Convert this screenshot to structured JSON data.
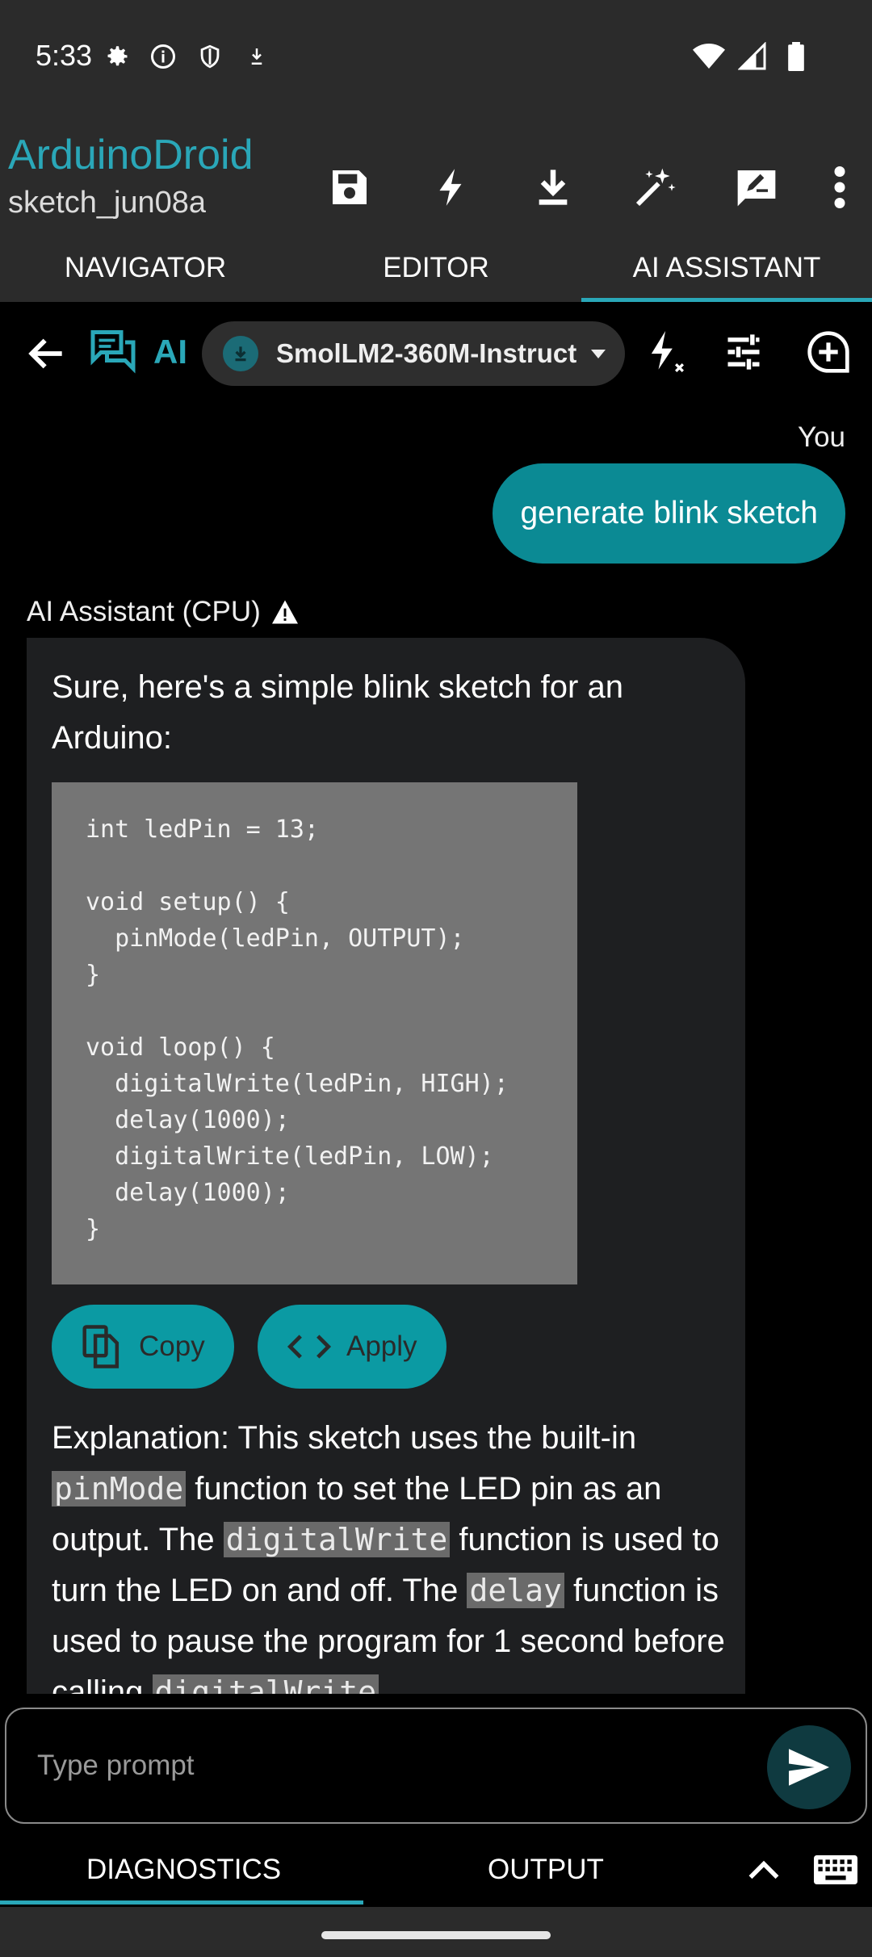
{
  "status_bar": {
    "time": "5:33"
  },
  "app": {
    "title": "ArduinoDroid",
    "subtitle": "sketch_jun08a"
  },
  "tabs": [
    {
      "label": "NAVIGATOR",
      "active": false
    },
    {
      "label": "EDITOR",
      "active": false
    },
    {
      "label": "AI ASSISTANT",
      "active": true
    }
  ],
  "chat_toolbar": {
    "ai_label": "AI",
    "model": "SmolLM2-360M-Instruct"
  },
  "messages": {
    "user_label": "You",
    "user_text": "generate blink sketch",
    "ai_label": "AI Assistant (CPU)",
    "ai_intro": "Sure, here's a simple blink sketch for an Arduino:",
    "code": "int ledPin = 13;\n\nvoid setup() {\n  pinMode(ledPin, OUTPUT);\n}\n\nvoid loop() {\n  digitalWrite(ledPin, HIGH);\n  delay(1000);\n  digitalWrite(ledPin, LOW);\n  delay(1000);\n}",
    "copy_label": "Copy",
    "apply_label": "Apply",
    "explanation": {
      "t1": "Explanation: This sketch uses the built-in ",
      "c1": "pinMode",
      "t2": " function to set the LED pin as an output. The ",
      "c2": "digitalWrite",
      "t3": " function is used to turn the LED on and off. The ",
      "c3": "delay",
      "t4": " function is used to pause the program for 1 second before calling ",
      "c4": "digitalWrite"
    }
  },
  "input": {
    "placeholder": "Type prompt"
  },
  "bottom_tabs": {
    "diagnostics": "DIAGNOSTICS",
    "output": "OUTPUT"
  },
  "colors": {
    "accent": "#2aa7b8",
    "user_bubble": "#0b8a94",
    "bar": "#2b2b2b"
  }
}
